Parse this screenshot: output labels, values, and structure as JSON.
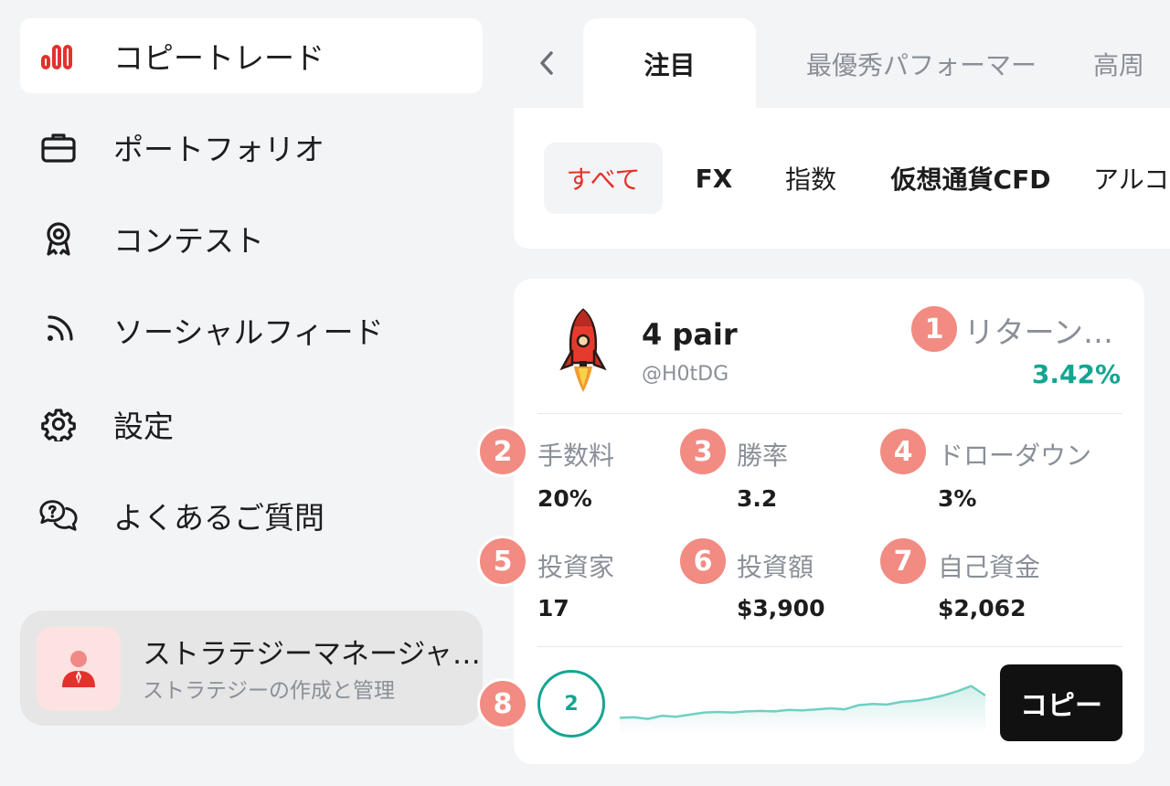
{
  "sidebar": {
    "items": [
      {
        "label": "コピートレード",
        "icon": "bar-chart-icon",
        "active": true
      },
      {
        "label": "ポートフォリオ",
        "icon": "briefcase-icon"
      },
      {
        "label": "コンテスト",
        "icon": "award-icon"
      },
      {
        "label": "ソーシャルフィード",
        "icon": "rss-icon"
      },
      {
        "label": "設定",
        "icon": "gear-icon"
      },
      {
        "label": "よくあるご質問",
        "icon": "faq-chat-icon"
      }
    ],
    "strategy_manager": {
      "title": "ストラテジーマネージャ…",
      "subtitle": "ストラテジーの作成と管理",
      "icon": "manager-person-icon"
    }
  },
  "tabs": {
    "back_icon": "chevron-left-icon",
    "items": [
      {
        "label": "注目",
        "active": true
      },
      {
        "label": "最優秀パフォーマー"
      },
      {
        "label": "高周"
      }
    ]
  },
  "filters": {
    "items": [
      {
        "label": "すべて",
        "active": true
      },
      {
        "label": "FX"
      },
      {
        "label": "指数"
      },
      {
        "label": "仮想通貨CFD"
      },
      {
        "label": "アルコ"
      }
    ]
  },
  "trader": {
    "avatar_icon": "rocket-avatar-icon",
    "name": "4 pair",
    "handle": "@H0tDG",
    "return_label": "リターン…",
    "return_value": "3.42%",
    "stats": [
      {
        "label": "手数料",
        "value": "20%"
      },
      {
        "label": "勝率",
        "value": "3.2"
      },
      {
        "label": "ドローダウン",
        "value": "3%"
      },
      {
        "label": "投資家",
        "value": "17"
      },
      {
        "label": "投資額",
        "value": "$3,900"
      },
      {
        "label": "自己資金",
        "value": "$2,062"
      }
    ],
    "rank": "2",
    "copy_label": "コピー",
    "sparkline": [
      0.2,
      0.21,
      0.18,
      0.24,
      0.22,
      0.26,
      0.3,
      0.31,
      0.3,
      0.32,
      0.33,
      0.32,
      0.35,
      0.34,
      0.36,
      0.38,
      0.36,
      0.44,
      0.46,
      0.45,
      0.5,
      0.52,
      0.56,
      0.62,
      0.7,
      0.8,
      0.62
    ]
  },
  "annotations": [
    "1",
    "2",
    "3",
    "4",
    "5",
    "6",
    "7",
    "8"
  ],
  "colors": {
    "accent_red": "#e5312b",
    "positive_green": "#14a591",
    "badge_salmon": "#f28b82",
    "muted_text": "#8a8f98",
    "background": "#f3f4f6"
  }
}
